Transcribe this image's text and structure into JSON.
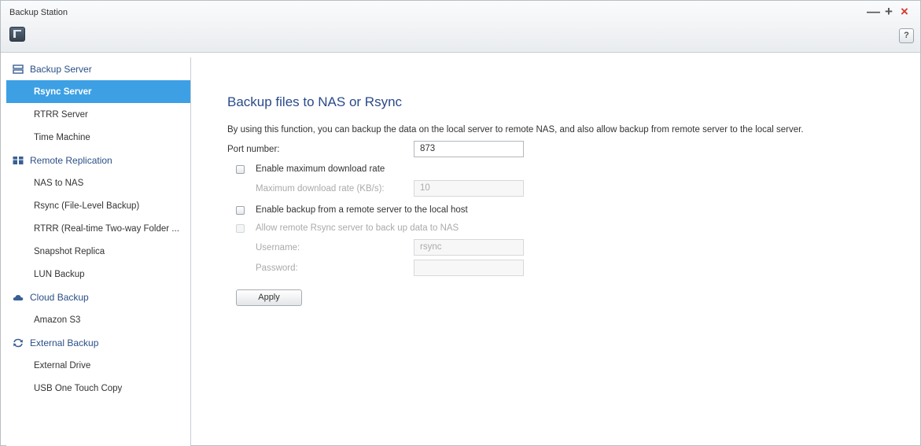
{
  "window": {
    "title": "Backup Station",
    "help_label": "?"
  },
  "window_controls": {
    "minimize": "—",
    "maximize": "+",
    "close": "×"
  },
  "sidebar": {
    "sections": [
      {
        "label": "Backup Server",
        "icon": "server-icon",
        "items": [
          {
            "label": "Rsync Server",
            "active": true
          },
          {
            "label": "RTRR Server"
          },
          {
            "label": "Time Machine"
          }
        ]
      },
      {
        "label": "Remote Replication",
        "icon": "replication-icon",
        "items": [
          {
            "label": "NAS to NAS"
          },
          {
            "label": "Rsync (File-Level Backup)"
          },
          {
            "label": "RTRR (Real-time Two-way Folder ..."
          },
          {
            "label": "Snapshot Replica"
          },
          {
            "label": "LUN Backup"
          }
        ]
      },
      {
        "label": "Cloud Backup",
        "icon": "cloud-icon",
        "items": [
          {
            "label": "Amazon S3"
          }
        ]
      },
      {
        "label": "External Backup",
        "icon": "sync-arrows-icon",
        "items": [
          {
            "label": "External Drive"
          },
          {
            "label": "USB One Touch Copy"
          }
        ]
      }
    ]
  },
  "main": {
    "heading": "Backup files to NAS or Rsync",
    "description": "By using this function, you can backup the data on the local server to remote NAS, and also allow backup from remote server to the local server.",
    "port": {
      "label": "Port number:",
      "value": "873"
    },
    "max_download": {
      "label": "Enable maximum download rate",
      "checked": false
    },
    "download_rate": {
      "label": "Maximum download rate (KB/s):",
      "value": "10"
    },
    "remote_backup": {
      "label": "Enable backup from a remote server to the local host",
      "checked": false
    },
    "allow_rsync": {
      "label": "Allow remote Rsync server to back up data to NAS",
      "checked": false
    },
    "username": {
      "label": "Username:",
      "value": "rsync"
    },
    "password": {
      "label": "Password:",
      "value": ""
    },
    "apply_label": "Apply"
  },
  "colors": {
    "accent": "#3da0e4",
    "heading": "#2a4a8a",
    "close": "#d83a2e"
  }
}
